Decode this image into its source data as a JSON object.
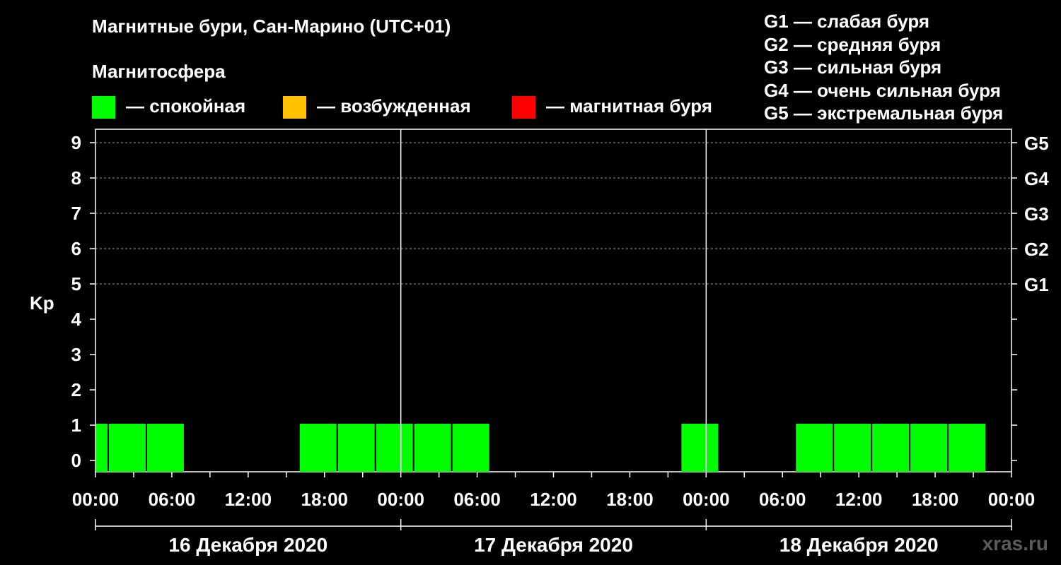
{
  "title": "Магнитные бури, Сан-Марино (UTC+01)",
  "subtitle": "Магнитосфера",
  "legend": [
    {
      "label": "— спокойная",
      "color": "#00ff00"
    },
    {
      "label": "— возбужденная",
      "color": "#ffc000"
    },
    {
      "label": "— магнитная буря",
      "color": "#ff0000"
    }
  ],
  "g_legend": [
    "G1 — слабая буря",
    "G2 — средняя буря",
    "G3 — сильная буря",
    "G4 — очень сильная буря",
    "G5 — экстремальная буря"
  ],
  "watermark": "xras.ru",
  "chart_data": {
    "type": "bar",
    "title": "Магнитные бури, Сан-Марино (UTC+01)",
    "ylabel": "Kp",
    "ylim": [
      0,
      9
    ],
    "yticks": [
      "0",
      "1",
      "2",
      "3",
      "4",
      "5",
      "6",
      "7",
      "8",
      "9"
    ],
    "right_ticks": [
      {
        "kp": 5,
        "label": "G1"
      },
      {
        "kp": 6,
        "label": "G2"
      },
      {
        "kp": 7,
        "label": "G3"
      },
      {
        "kp": 8,
        "label": "G4"
      },
      {
        "kp": 9,
        "label": "G5"
      }
    ],
    "x_tick_labels": [
      "00:00",
      "06:00",
      "12:00",
      "18:00",
      "00:00",
      "06:00",
      "12:00",
      "18:00",
      "00:00",
      "06:00",
      "12:00",
      "18:00",
      "00:00"
    ],
    "days": [
      "16 Декабря 2020",
      "17 Декабря 2020",
      "18 Декабря 2020"
    ],
    "grid": "dashed horizontal at Kp 5–9",
    "colors": {
      "quiet": "#00ff00",
      "active": "#ffc000",
      "storm": "#ff0000"
    },
    "bars": [
      {
        "day": "16 Декабря 2020",
        "start": "00:00",
        "end": "01:00",
        "kp": 1,
        "state": "quiet"
      },
      {
        "day": "16 Декабря 2020",
        "start": "01:00",
        "end": "04:00",
        "kp": 1,
        "state": "quiet"
      },
      {
        "day": "16 Декабря 2020",
        "start": "04:00",
        "end": "07:00",
        "kp": 1,
        "state": "quiet"
      },
      {
        "day": "16 Декабря 2020",
        "start": "16:00",
        "end": "19:00",
        "kp": 1,
        "state": "quiet"
      },
      {
        "day": "16 Декабря 2020",
        "start": "19:00",
        "end": "22:00",
        "kp": 1,
        "state": "quiet"
      },
      {
        "day": "16 Декабря 2020",
        "start": "22:00",
        "end": "01:00",
        "kp": 1,
        "state": "quiet"
      },
      {
        "day": "17 Декабря 2020",
        "start": "01:00",
        "end": "04:00",
        "kp": 1,
        "state": "quiet"
      },
      {
        "day": "17 Декабря 2020",
        "start": "04:00",
        "end": "07:00",
        "kp": 1,
        "state": "quiet"
      },
      {
        "day": "17 Декабря 2020",
        "start": "22:00",
        "end": "01:00",
        "kp": 1,
        "state": "quiet"
      },
      {
        "day": "18 Декабря 2020",
        "start": "07:00",
        "end": "10:00",
        "kp": 1,
        "state": "quiet"
      },
      {
        "day": "18 Декабря 2020",
        "start": "10:00",
        "end": "13:00",
        "kp": 1,
        "state": "quiet"
      },
      {
        "day": "18 Декабря 2020",
        "start": "13:00",
        "end": "16:00",
        "kp": 1,
        "state": "quiet"
      },
      {
        "day": "18 Декабря 2020",
        "start": "16:00",
        "end": "19:00",
        "kp": 1,
        "state": "quiet"
      },
      {
        "day": "18 Декабря 2020",
        "start": "19:00",
        "end": "22:00",
        "kp": 1,
        "state": "quiet"
      }
    ]
  }
}
